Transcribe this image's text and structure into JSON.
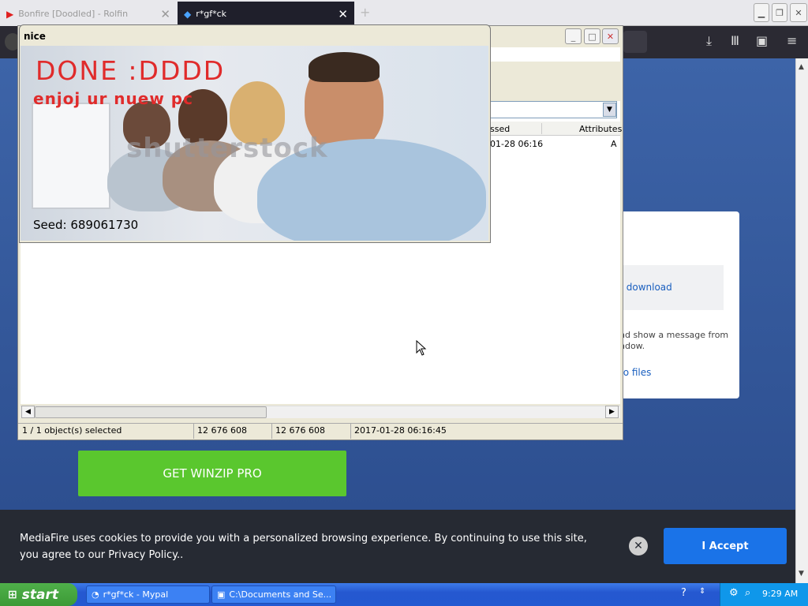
{
  "browser": {
    "tabs": [
      {
        "label": "Bonfire [Doodled] - Rolfin",
        "active": false
      },
      {
        "label": "r*gf*ck",
        "active": true
      }
    ],
    "colors": {
      "tabbar": "#e8e8ec",
      "navbar": "#2b2a33"
    }
  },
  "page": {
    "card_download": "r download",
    "card_message": "nd show a message from\nndow.",
    "card_files": "to files",
    "winzip_button": "GET WINZIP PRO",
    "cookie_text": "MediaFire uses cookies to provide you with a personalized browsing experience. By continuing to use this site, you agree to our Privacy Policy..",
    "accept_button": "I Accept",
    "colors": {
      "accent": "#1a73e8",
      "winzip": "#5ac72e"
    }
  },
  "zip_window": {
    "header_col1": "ssed",
    "header_col2": "Attributes",
    "row_date": "01-28 06:16",
    "row_attr": "A",
    "status": {
      "selection": "1 / 1 object(s) selected",
      "size": "12 676 608",
      "packed": "12 676 608",
      "modified": "2017-01-28 06:16:45"
    }
  },
  "nice_window": {
    "title": "nice",
    "image_text_1": "DONE :DDDD",
    "image_text_2": "enjoj ur nuew pc",
    "watermark": "shutterstock",
    "seed": "Seed: 689061730"
  },
  "taskbar": {
    "start": "start",
    "tasks": [
      {
        "label": "r*gf*ck - Mypal"
      },
      {
        "label": "C:\\Documents and Se..."
      }
    ],
    "clock": "9:29 AM"
  }
}
